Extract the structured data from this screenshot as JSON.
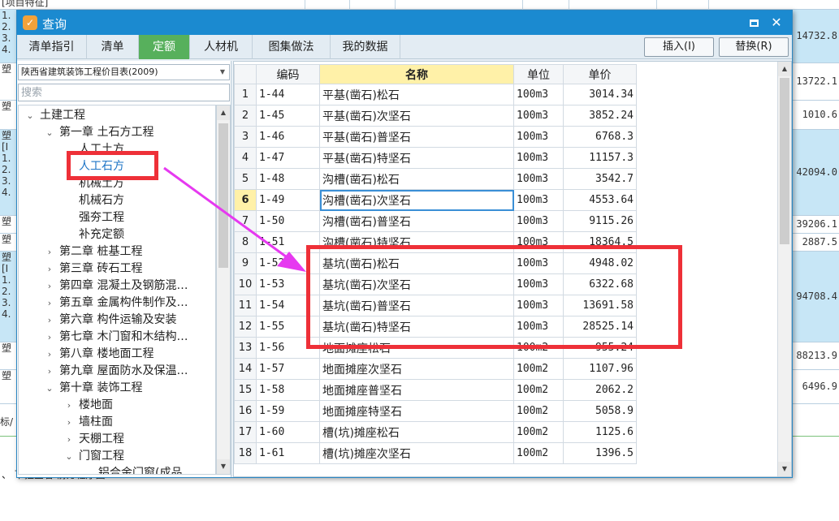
{
  "background": {
    "header_text": "[项目特征]",
    "rows": [
      {
        "left": "1.\n2.\n3.\n4.",
        "value": "14732.8",
        "tone": "blue"
      },
      {
        "left": "塑",
        "value": "13722.1",
        "tone": "white"
      },
      {
        "left": "塑",
        "value": "1010.6",
        "tone": "white"
      },
      {
        "left": "塑\n[I\n1.\n2.\n3.\n4.",
        "value": "42094.0",
        "tone": "blue"
      },
      {
        "left": "塑",
        "value": "39206.1",
        "tone": "white"
      },
      {
        "left": "塑",
        "value": "2887.5",
        "tone": "white"
      },
      {
        "left": "塑\n[I\n1.\n2.\n3.\n4.",
        "value": "94708.4",
        "tone": "blue"
      },
      {
        "left": "塑",
        "value": "88213.9",
        "tone": "white"
      },
      {
        "left": "塑",
        "value": "6496.9",
        "tone": "white"
      }
    ],
    "bottom_left_label": "标/",
    "bottom_text": "、 下拉查看 前方程序图"
  },
  "dialog": {
    "title": "查询",
    "icon_glyph": "✓",
    "close_glyph": "✕",
    "tabs": [
      {
        "label": "清单指引",
        "active": false
      },
      {
        "label": "清单",
        "active": false
      },
      {
        "label": "定额",
        "active": true
      },
      {
        "label": "人材机",
        "active": false
      },
      {
        "label": "图集做法",
        "active": false
      },
      {
        "label": "我的数据",
        "active": false
      }
    ],
    "insert_label": "插入(I)",
    "replace_label": "替换(R)"
  },
  "left_panel": {
    "library": "陕西省建筑装饰工程价目表(2009)",
    "search_placeholder": "搜索",
    "tree": [
      {
        "label": "土建工程",
        "level": 0,
        "toggle": "expanded"
      },
      {
        "label": "第一章 土石方工程",
        "level": 1,
        "toggle": "expanded"
      },
      {
        "label": "人工土方",
        "level": 2,
        "toggle": "none"
      },
      {
        "label": "人工石方",
        "level": 2,
        "toggle": "none",
        "selected": true
      },
      {
        "label": "机械土方",
        "level": 2,
        "toggle": "none"
      },
      {
        "label": "机械石方",
        "level": 2,
        "toggle": "none"
      },
      {
        "label": "强夯工程",
        "level": 2,
        "toggle": "none"
      },
      {
        "label": "补充定额",
        "level": 2,
        "toggle": "none"
      },
      {
        "label": "第二章 桩基工程",
        "level": 1,
        "toggle": "collapsed"
      },
      {
        "label": "第三章 砖石工程",
        "level": 1,
        "toggle": "collapsed"
      },
      {
        "label": "第四章 混凝土及钢筋混…",
        "level": 1,
        "toggle": "collapsed"
      },
      {
        "label": "第五章 金属构件制作及…",
        "level": 1,
        "toggle": "collapsed"
      },
      {
        "label": "第六章 构件运输及安装",
        "level": 1,
        "toggle": "collapsed"
      },
      {
        "label": "第七章 木门窗和木结构…",
        "level": 1,
        "toggle": "collapsed"
      },
      {
        "label": "第八章 楼地面工程",
        "level": 1,
        "toggle": "collapsed"
      },
      {
        "label": "第九章 屋面防水及保温…",
        "level": 1,
        "toggle": "collapsed"
      },
      {
        "label": "第十章 装饰工程",
        "level": 1,
        "toggle": "expanded"
      },
      {
        "label": "楼地面",
        "level": 2,
        "toggle": "collapsed"
      },
      {
        "label": "墙柱面",
        "level": 2,
        "toggle": "collapsed"
      },
      {
        "label": "天棚工程",
        "level": 2,
        "toggle": "collapsed"
      },
      {
        "label": "门窗工程",
        "level": 2,
        "toggle": "expanded"
      },
      {
        "label": "铝合金门窗(成品…",
        "level": 3,
        "toggle": "none"
      }
    ]
  },
  "grid": {
    "headers": {
      "idx": "",
      "code": "编码",
      "name": "名称",
      "unit": "单位",
      "price": "单价"
    },
    "current_row": 6,
    "rows": [
      {
        "idx": "1",
        "code": "1-44",
        "name": "平基(凿石)松石",
        "unit": "100m3",
        "price": "3014.34"
      },
      {
        "idx": "2",
        "code": "1-45",
        "name": "平基(凿石)次坚石",
        "unit": "100m3",
        "price": "3852.24"
      },
      {
        "idx": "3",
        "code": "1-46",
        "name": "平基(凿石)普坚石",
        "unit": "100m3",
        "price": "6768.3"
      },
      {
        "idx": "4",
        "code": "1-47",
        "name": "平基(凿石)特坚石",
        "unit": "100m3",
        "price": "11157.3"
      },
      {
        "idx": "5",
        "code": "1-48",
        "name": "沟槽(凿石)松石",
        "unit": "100m3",
        "price": "3542.7"
      },
      {
        "idx": "6",
        "code": "1-49",
        "name": "沟槽(凿石)次坚石",
        "unit": "100m3",
        "price": "4553.64"
      },
      {
        "idx": "7",
        "code": "1-50",
        "name": "沟槽(凿石)普坚石",
        "unit": "100m3",
        "price": "9115.26"
      },
      {
        "idx": "8",
        "code": "1-51",
        "name": "沟槽(凿石)特坚石",
        "unit": "100m3",
        "price": "18364.5"
      },
      {
        "idx": "9",
        "code": "1-52",
        "name": "基坑(凿石)松石",
        "unit": "100m3",
        "price": "4948.02"
      },
      {
        "idx": "10",
        "code": "1-53",
        "name": "基坑(凿石)次坚石",
        "unit": "100m3",
        "price": "6322.68"
      },
      {
        "idx": "11",
        "code": "1-54",
        "name": "基坑(凿石)普坚石",
        "unit": "100m3",
        "price": "13691.58"
      },
      {
        "idx": "12",
        "code": "1-55",
        "name": "基坑(凿石)特坚石",
        "unit": "100m3",
        "price": "28525.14"
      },
      {
        "idx": "13",
        "code": "1-56",
        "name": "地面摊座松石",
        "unit": "100m2",
        "price": "955.24"
      },
      {
        "idx": "14",
        "code": "1-57",
        "name": "地面摊座次坚石",
        "unit": "100m2",
        "price": "1107.96"
      },
      {
        "idx": "15",
        "code": "1-58",
        "name": "地面摊座普坚石",
        "unit": "100m2",
        "price": "2062.2"
      },
      {
        "idx": "16",
        "code": "1-59",
        "name": "地面摊座特坚石",
        "unit": "100m2",
        "price": "5058.9"
      },
      {
        "idx": "17",
        "code": "1-60",
        "name": "槽(坑)摊座松石",
        "unit": "100m2",
        "price": "1125.6"
      },
      {
        "idx": "18",
        "code": "1-61",
        "name": "槽(坑)摊座次坚石",
        "unit": "100m2",
        "price": "1396.5"
      }
    ]
  },
  "colors": {
    "title_bar": "#1b8ad0",
    "active_tab": "#57b05c",
    "annotation_red": "#ee3038",
    "annotation_arrow": "#e639f0",
    "name_header": "#fff1a8"
  }
}
